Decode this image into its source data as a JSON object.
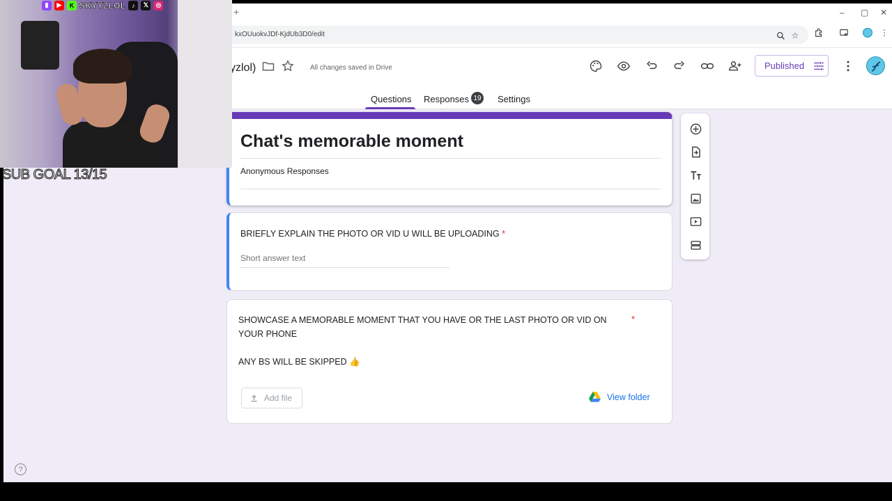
{
  "browser": {
    "url_partial": "kxOUuokvJDf-KjdUb3D0/edit",
    "new_tab_glyph": "+",
    "window_controls": [
      "–",
      "▢",
      "✕"
    ]
  },
  "header": {
    "doc_title_partial": "yzlol)",
    "save_status": "All changes saved in Drive",
    "publish_label": "Published",
    "icons": [
      "palette-icon",
      "preview-icon",
      "undo-icon",
      "redo-icon",
      "link-icon",
      "add-collaborator-icon",
      "more-vert-icon"
    ]
  },
  "tabs": [
    {
      "label": "Questions",
      "active": true
    },
    {
      "label": "Responses",
      "badge": "19"
    },
    {
      "label": "Settings"
    }
  ],
  "form": {
    "title": "Chat's memorable moment",
    "description": "Anonymous Responses",
    "questions": [
      {
        "text": "BRIEFLY EXPLAIN THE PHOTO OR VID U WILL BE UPLOADING",
        "required_mark": "*",
        "placeholder": "Short answer text"
      },
      {
        "text_line1": "SHOWCASE A MEMORABLE MOMENT THAT YOU HAVE OR THE LAST PHOTO OR VID ON",
        "text_line2": "YOUR PHONE",
        "text_line3": "ANY BS WILL BE SKIPPED 👍",
        "required_mark": "*",
        "add_file_label": "Add file",
        "view_folder_label": "View folder"
      }
    ]
  },
  "side_toolbar": [
    "add-question-icon",
    "import-questions-icon",
    "add-title-icon",
    "add-image-icon",
    "add-video-icon",
    "add-section-icon"
  ],
  "overlay": {
    "handle": "SKYYZLOL",
    "sub_goal": "SUB GOAL 13/15",
    "social_icons": [
      {
        "name": "twitch-icon",
        "glyph": "▮",
        "color": "#9146ff"
      },
      {
        "name": "youtube-icon",
        "glyph": "▶",
        "color": "#ff0000"
      },
      {
        "name": "kick-icon",
        "glyph": "K",
        "color": "#53fc18"
      },
      {
        "name": "tiktok-icon",
        "glyph": "♪",
        "color": "#111111"
      },
      {
        "name": "x-icon",
        "glyph": "𝕏",
        "color": "#111111"
      },
      {
        "name": "instagram-icon",
        "glyph": "◎",
        "color": "#d62976"
      }
    ]
  },
  "colors": {
    "accent": "#673ab7",
    "focus_bar": "#4285f4",
    "link": "#1a73e8",
    "required": "#d93025",
    "page_bg": "#efebf7"
  }
}
